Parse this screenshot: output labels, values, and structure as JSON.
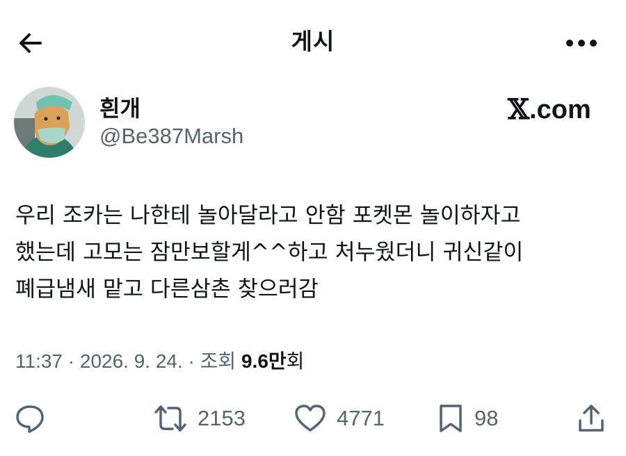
{
  "header": {
    "title": "게시",
    "back_icon": "arrow-left-icon",
    "more_icon": "more-horizontal-icon"
  },
  "author": {
    "display_name": "흰개",
    "handle": "@Be387Marsh",
    "avatar_icon": "dog-avatar"
  },
  "brand": {
    "x_mark": "𝕏",
    "domain": ".com"
  },
  "tweet": {
    "lines": [
      "우리 조카는 나한테 놀아달라고 안함 포켓몬 놀이하자고",
      "했는데 고모는 잠만보할게^^하고 처누웠더니 귀신같이",
      "폐급냄새 맡고 다른삼촌 찾으러감"
    ]
  },
  "meta": {
    "time": "11:37 · 2026. 9. 24. · 조회 ",
    "views_count": "9.6만",
    "views_unit": "회"
  },
  "actions": {
    "reply": {
      "icon": "reply-icon"
    },
    "retweet": {
      "icon": "retweet-icon",
      "count": "2153"
    },
    "like": {
      "icon": "heart-icon",
      "count": "4771"
    },
    "bookmark": {
      "icon": "bookmark-icon",
      "count": "98"
    },
    "share": {
      "icon": "share-icon"
    }
  },
  "colors": {
    "text": "#0f1419",
    "secondary": "#536471",
    "background": "#ffffff"
  }
}
